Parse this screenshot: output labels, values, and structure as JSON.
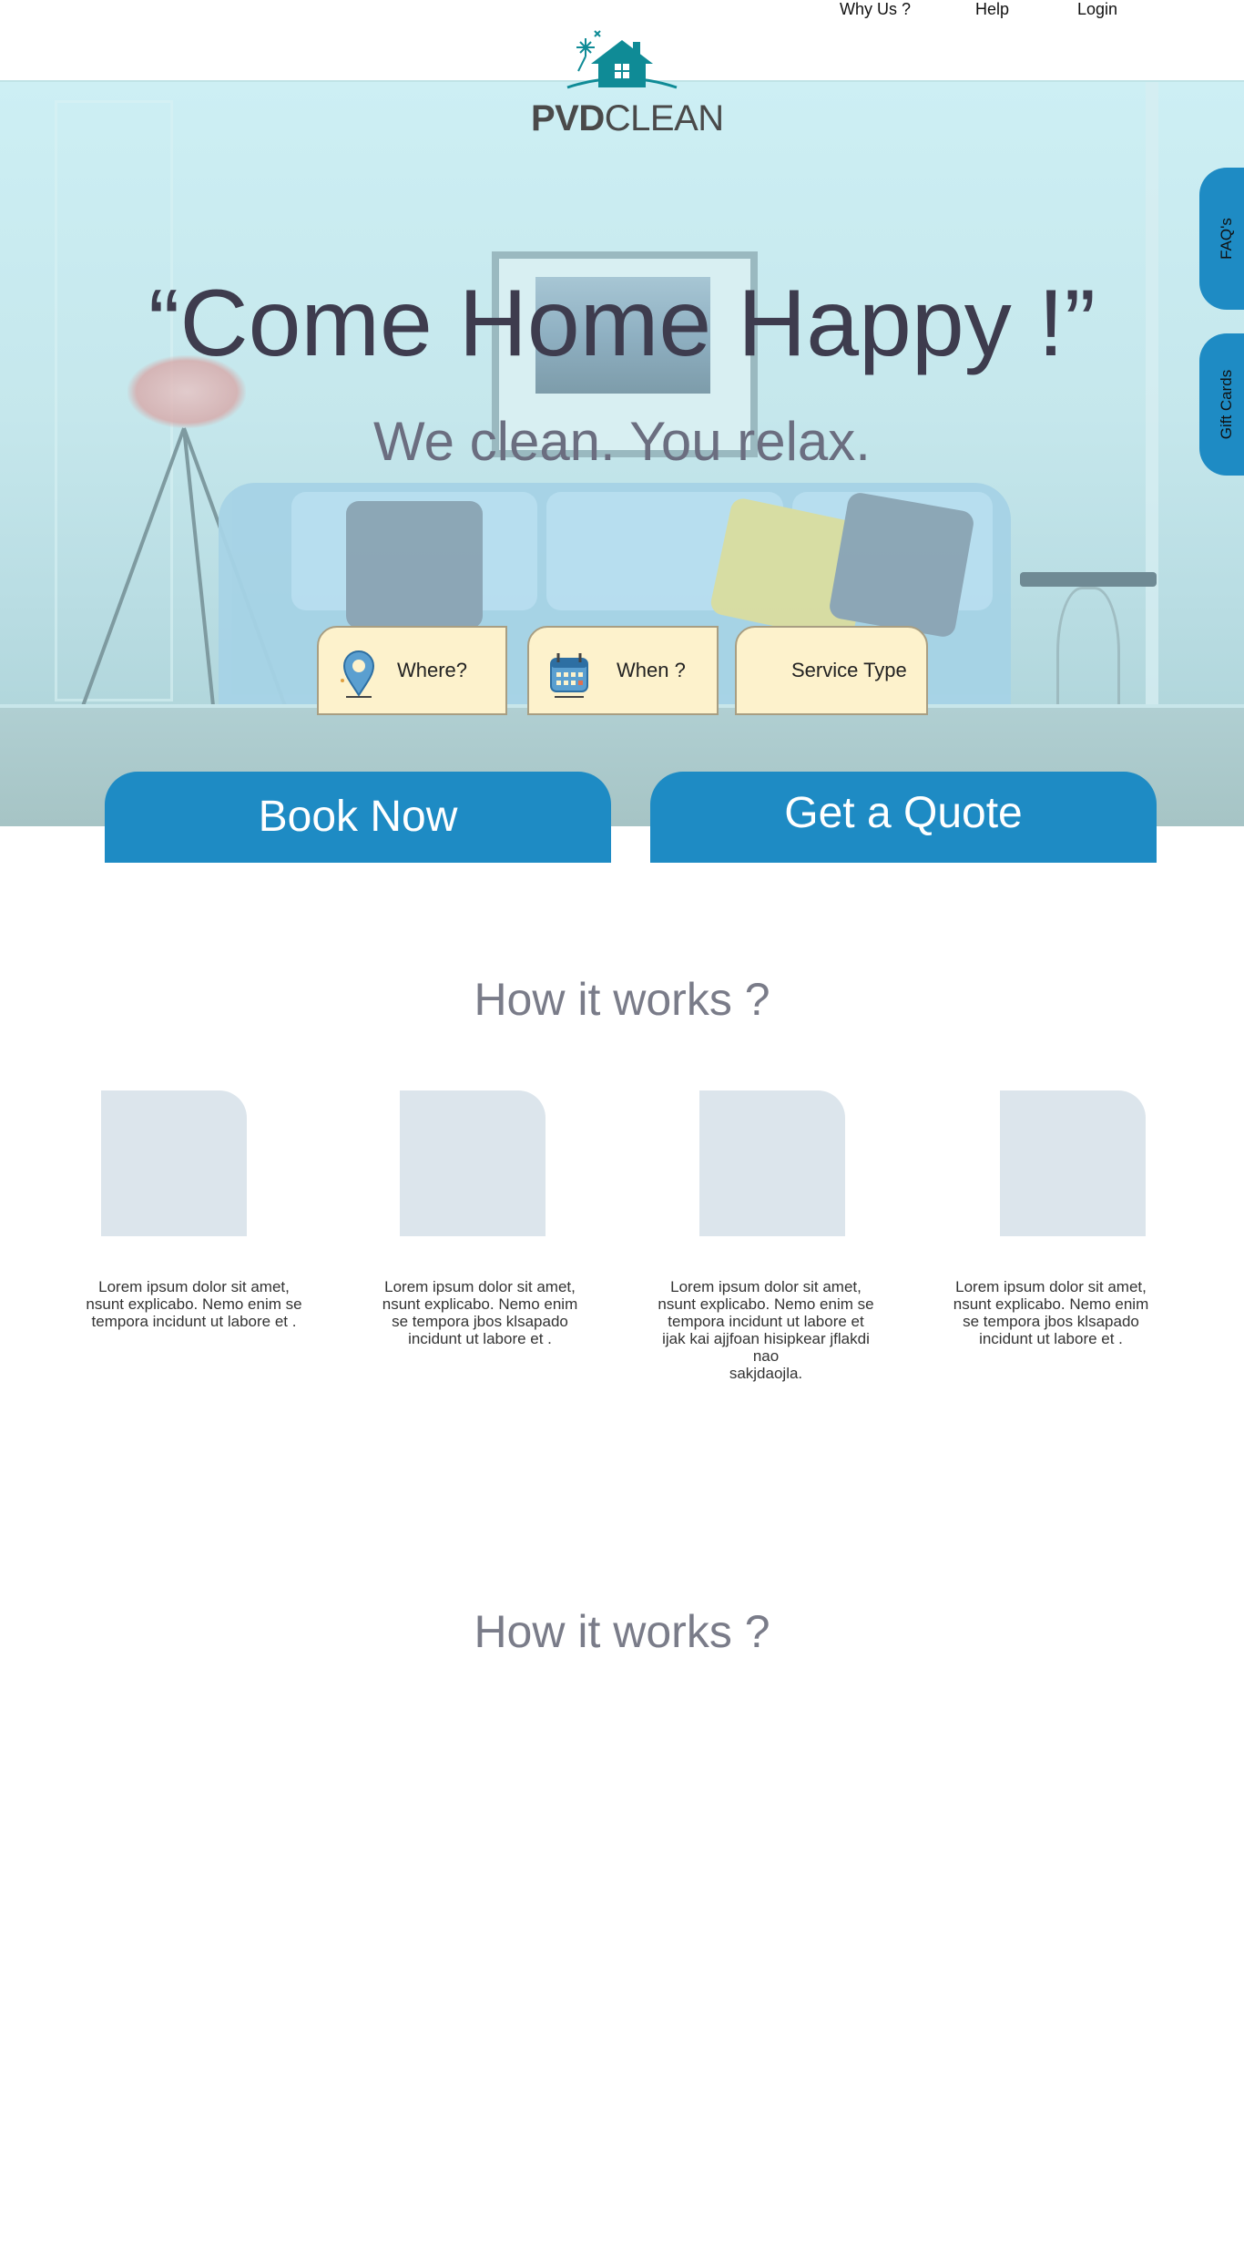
{
  "header": {
    "logo": {
      "brand_bold": "PVD",
      "brand_light": "CLEAN"
    },
    "nav": [
      {
        "label": "Why Us ?"
      },
      {
        "label": "Help"
      },
      {
        "label": "Login"
      }
    ]
  },
  "hero": {
    "title": "“Come Home Happy !”",
    "subtitle": "We clean. You relax.",
    "search": {
      "where": "Where?",
      "when": "When ?",
      "service": "Service Type"
    },
    "buttons": {
      "book": "Book Now",
      "quote": "Get a Quote"
    }
  },
  "side_tabs": [
    {
      "label": "FAQ's"
    },
    {
      "label": "Gift Cards"
    }
  ],
  "how_it_works": {
    "title": "How it works ?",
    "steps": [
      {
        "text": "Lorem ipsum dolor sit amet,\nnsunt explicabo. Nemo enim se\ntempora incidunt ut labore et ."
      },
      {
        "text": "Lorem ipsum dolor sit amet,\nnsunt explicabo.  Nemo enim\nse tempora jbos klsapado\nincidunt ut labore et ."
      },
      {
        "text": "Lorem ipsum dolor sit amet,\nnsunt explicabo. Nemo enim se\ntempora incidunt ut labore et\nijak kai ajjfoan hisipkear jflakdi\nnao\nsakjdaojla."
      },
      {
        "text": "Lorem ipsum dolor sit amet,\nnsunt explicabo.  Nemo enim\nse tempora jbos klsapado\nincidunt ut labore et ."
      }
    ]
  },
  "how_it_works_2": {
    "title": "How it works ?"
  },
  "colors": {
    "brand_blue": "#1e8bc4",
    "logo_teal": "#0f8b96",
    "search_bg": "#fdf2cc",
    "heading_gray": "#7a7c89"
  },
  "icons": [
    "house-sparkle-logo-icon",
    "map-pin-icon",
    "calendar-icon"
  ]
}
